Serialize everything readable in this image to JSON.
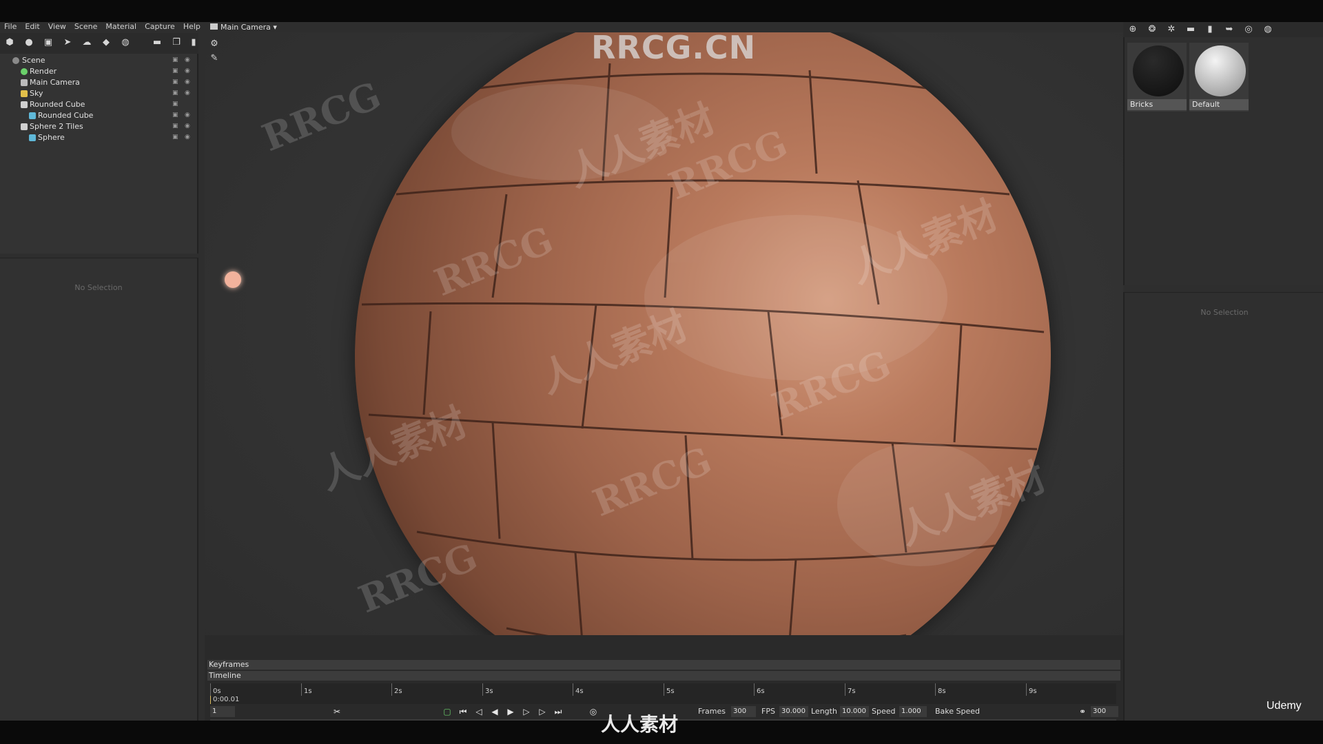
{
  "brand": {
    "site": "RRCG.CN",
    "footer_logo": "人人素材",
    "udemy": "Udemy"
  },
  "menu": [
    "File",
    "Edit",
    "View",
    "Scene",
    "Material",
    "Capture",
    "Help"
  ],
  "viewport": {
    "camera": "Main Camera ▾"
  },
  "scene_tree": [
    {
      "label": "Scene",
      "indent": 0,
      "color": "#8a8a8a"
    },
    {
      "label": "Render",
      "indent": 1,
      "color": "#6ad06a"
    },
    {
      "label": "Main Camera",
      "indent": 1,
      "color": "#bbbbbb"
    },
    {
      "label": "Sky",
      "indent": 1,
      "color": "#e2c04a"
    },
    {
      "label": "Rounded Cube",
      "indent": 1,
      "color": "#cfcfcf"
    },
    {
      "label": "Rounded Cube",
      "indent": 2,
      "color": "#5fb8d8"
    },
    {
      "label": "Sphere 2 Tiles",
      "indent": 1,
      "color": "#cfcfcf"
    },
    {
      "label": "Sphere",
      "indent": 2,
      "color": "#5fb8d8"
    }
  ],
  "left_panel": {
    "no_selection": "No Selection"
  },
  "materials": [
    {
      "name": "Bricks",
      "ball": "#141414"
    },
    {
      "name": "Default",
      "ball": "#d8d8d8"
    }
  ],
  "right_panel": {
    "no_selection": "No Selection"
  },
  "timeline": {
    "keyframes_label": "Keyframes",
    "timeline_label": "Timeline",
    "current_time": "0:00.01",
    "ticks": [
      "0s",
      "1s",
      "2s",
      "3s",
      "4s",
      "5s",
      "6s",
      "7s",
      "8s",
      "9s"
    ],
    "frame_field": "1",
    "frames_label": "Frames",
    "frames": "300",
    "fps_label": "FPS",
    "fps": "30.000",
    "length_label": "Length",
    "length": "10.000",
    "speed_label": "Speed",
    "speed": "1.000",
    "bake_speed": "Bake Speed",
    "end_frame": "300"
  },
  "watermarks": [
    "RRCG",
    "人人素材"
  ]
}
